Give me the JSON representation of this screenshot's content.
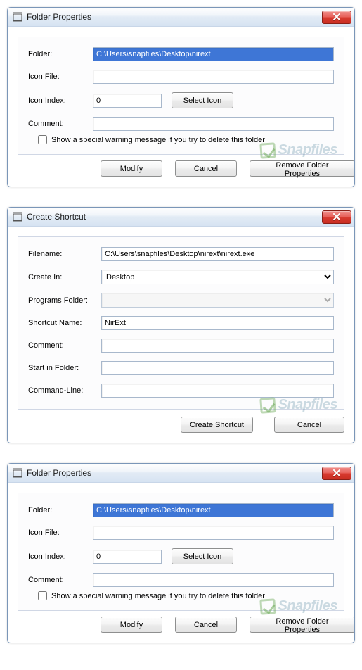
{
  "watermark": "Snapfiles",
  "dialog1": {
    "title": "Folder Properties",
    "labels": {
      "folder": "Folder:",
      "iconFile": "Icon File:",
      "iconIndex": "Icon Index:",
      "comment": "Comment:"
    },
    "values": {
      "folder": "C:\\Users\\snapfiles\\Desktop\\nirext",
      "iconFile": "",
      "iconIndex": "0",
      "comment": ""
    },
    "buttons": {
      "selectIcon": "Select Icon",
      "modify": "Modify",
      "cancel": "Cancel",
      "remove": "Remove Folder Properties"
    },
    "checkboxLabel": "Show a special warning message if you try to delete this folder"
  },
  "dialog2": {
    "title": "Create Shortcut",
    "labels": {
      "filename": "Filename:",
      "createIn": "Create In:",
      "programsFolder": "Programs Folder:",
      "shortcutName": "Shortcut Name:",
      "comment": "Comment:",
      "startIn": "Start in Folder:",
      "cmdLine": "Command-Line:"
    },
    "values": {
      "filename": "C:\\Users\\snapfiles\\Desktop\\nirext\\nirext.exe",
      "createIn": "Desktop",
      "programsFolder": "",
      "shortcutName": "NirExt",
      "comment": "",
      "startIn": "",
      "cmdLine": ""
    },
    "buttons": {
      "create": "Create Shortcut",
      "cancel": "Cancel"
    }
  },
  "dialog3": {
    "title": "Folder Properties",
    "labels": {
      "folder": "Folder:",
      "iconFile": "Icon File:",
      "iconIndex": "Icon Index:",
      "comment": "Comment:"
    },
    "values": {
      "folder": "C:\\Users\\snapfiles\\Desktop\\nirext",
      "iconFile": "",
      "iconIndex": "0",
      "comment": ""
    },
    "buttons": {
      "selectIcon": "Select Icon",
      "modify": "Modify",
      "cancel": "Cancel",
      "remove": "Remove Folder Properties"
    },
    "checkboxLabel": "Show a special warning message if you try to delete this folder"
  }
}
